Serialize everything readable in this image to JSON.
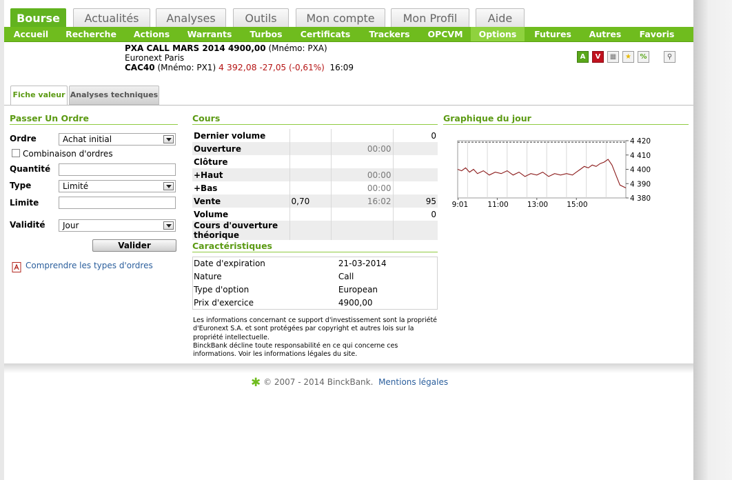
{
  "top_tabs": [
    {
      "label": "Bourse",
      "active": true
    },
    {
      "label": "Actualités",
      "active": false
    },
    {
      "label": "Analyses",
      "active": false
    },
    {
      "label": "Outils",
      "active": false
    },
    {
      "label": "Mon compte",
      "active": false
    },
    {
      "label": "Mon Profil",
      "active": false
    },
    {
      "label": "Aide",
      "active": false
    }
  ],
  "nav": [
    {
      "label": "Accueil"
    },
    {
      "label": "Recherche"
    },
    {
      "label": "Actions"
    },
    {
      "label": "Warrants"
    },
    {
      "label": "Turbos"
    },
    {
      "label": "Certificats"
    },
    {
      "label": "Trackers"
    },
    {
      "label": "OPCVM"
    },
    {
      "label": "Options",
      "active": true
    },
    {
      "label": "Futures"
    },
    {
      "label": "Autres"
    },
    {
      "label": "Favoris"
    }
  ],
  "instrument": {
    "name": "PXA CALL MARS 2014 4900,00",
    "mnemo": "(Mnémo: PXA)",
    "market": "Euronext Paris",
    "underlying": "CAC40",
    "underlying_mnemo": "(Mnémo: PX1)",
    "price": "4 392,08",
    "change": "-27,05",
    "change_pct": "(-0,61%)",
    "time": "16:09"
  },
  "icons": [
    {
      "name": "buy-icon",
      "glyph": "A",
      "color": "#5aa71a"
    },
    {
      "name": "sell-icon",
      "glyph": "V",
      "color": "#c0121f"
    },
    {
      "name": "portfolio-icon",
      "glyph": "▦",
      "color": "#777777"
    },
    {
      "name": "favorite-star-icon",
      "glyph": "★",
      "color": "#e6b800"
    },
    {
      "name": "alert-icon",
      "glyph": "%",
      "color": "#5aa71a"
    },
    {
      "name": "magnifier-icon",
      "glyph": "⚲",
      "color": "#555555"
    }
  ],
  "sub_tabs": [
    {
      "label": "Fiche valeur",
      "active": true
    },
    {
      "label": "Analyses techniques",
      "active": false
    }
  ],
  "order": {
    "title": "Passer Un Ordre",
    "ordre_label": "Ordre",
    "ordre_value": "Achat initial",
    "combinaison_label": "Combinaison d'ordres",
    "quantite_label": "Quantité",
    "type_label": "Type",
    "type_value": "Limité",
    "limite_label": "Limite",
    "validite_label": "Validité",
    "validite_value": "Jour",
    "submit_label": "Valider",
    "help_link": "Comprendre les types d'ordres"
  },
  "cours": {
    "title": "Cours",
    "rows": [
      {
        "label": "Dernier volume",
        "c1": "",
        "c2": "",
        "c3": "0"
      },
      {
        "label": "Ouverture",
        "c1": "",
        "c2": "00:00",
        "c3": ""
      },
      {
        "label": "Clôture",
        "c1": "",
        "c2": "",
        "c3": ""
      },
      {
        "label": "+Haut",
        "c1": "",
        "c2": "00:00",
        "c3": ""
      },
      {
        "label": "+Bas",
        "c1": "",
        "c2": "00:00",
        "c3": ""
      },
      {
        "label": "Vente",
        "c1": "0,70",
        "c2": "16:02",
        "c3": "95"
      },
      {
        "label": "Volume",
        "c1": "",
        "c2": "",
        "c3": "0"
      },
      {
        "label": "Cours d'ouverture théorique",
        "c1": "",
        "c2": "",
        "c3": ""
      }
    ]
  },
  "caracteristiques": {
    "title": "Caractéristiques",
    "rows": [
      {
        "label": "Date d'expiration",
        "value": "21-03-2014"
      },
      {
        "label": "Nature",
        "value": "Call"
      },
      {
        "label": "Type d'option",
        "value": "European"
      },
      {
        "label": "Prix d'exercice",
        "value": "4900,00"
      }
    ]
  },
  "disclaimer": {
    "line1": "Les informations concernant ce support d'investissement sont la propriété d'Euronext S.A. et sont protégées par copyright et autres lois sur la propriété intellectuelle.",
    "line2": "BinckBank décline toute responsabilité en ce qui concerne ces informations. Voir les informations légales du site."
  },
  "chart_data": {
    "type": "line",
    "title": "Graphique du jour",
    "xlabel": "",
    "ylabel": "",
    "x_ticks": [
      "9:01",
      "11:00",
      "13:00",
      "15:00"
    ],
    "y_ticks": [
      "4 420",
      "4 410",
      "4 400",
      "4 390",
      "4 380"
    ],
    "ylim": [
      4380,
      4420
    ],
    "xlim_hours": [
      9.0,
      17.5
    ],
    "grid": true,
    "reference_line": 4419,
    "series": [
      {
        "color": "#8b1a1a",
        "x": [
          9.0,
          9.2,
          9.4,
          9.6,
          9.8,
          10.0,
          10.3,
          10.6,
          10.9,
          11.2,
          11.5,
          11.8,
          12.1,
          12.4,
          12.7,
          13.0,
          13.3,
          13.6,
          13.9,
          14.2,
          14.5,
          14.8,
          15.0,
          15.2,
          15.4,
          15.6,
          15.8,
          16.0,
          16.2,
          16.4,
          16.6,
          16.8,
          17.0,
          17.2,
          17.5
        ],
        "y": [
          4400,
          4399,
          4401,
          4398,
          4400,
          4397,
          4399,
          4396,
          4398,
          4397,
          4399,
          4396,
          4398,
          4395,
          4397,
          4396,
          4398,
          4395,
          4397,
          4396,
          4397,
          4396,
          4398,
          4400,
          4402,
          4401,
          4403,
          4402,
          4404,
          4405,
          4407,
          4403,
          4396,
          4389,
          4387
        ]
      }
    ]
  },
  "footer": {
    "copyright": "© 2007 - 2014 BinckBank.",
    "legal_link": "Mentions légales"
  }
}
